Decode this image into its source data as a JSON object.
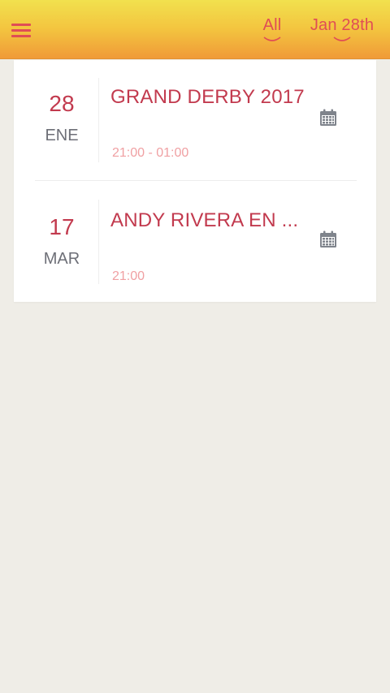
{
  "header": {
    "filter_all": "All",
    "filter_date": "Jan 28th"
  },
  "events": [
    {
      "day": "28",
      "month": "ENE",
      "title": "GRAND DERBY 2017",
      "time": "21:00 - 01:00",
      "icon": "calendar-icon"
    },
    {
      "day": "17",
      "month": "MAR",
      "title": "ANDY RIVERA EN ...",
      "time": "21:00",
      "icon": "calendar-icon"
    }
  ],
  "colors": {
    "accent": "#e04d55",
    "title": "#c23a4e",
    "header_top": "#f2e14e",
    "header_bottom": "#f09a38",
    "background": "#efede7"
  }
}
